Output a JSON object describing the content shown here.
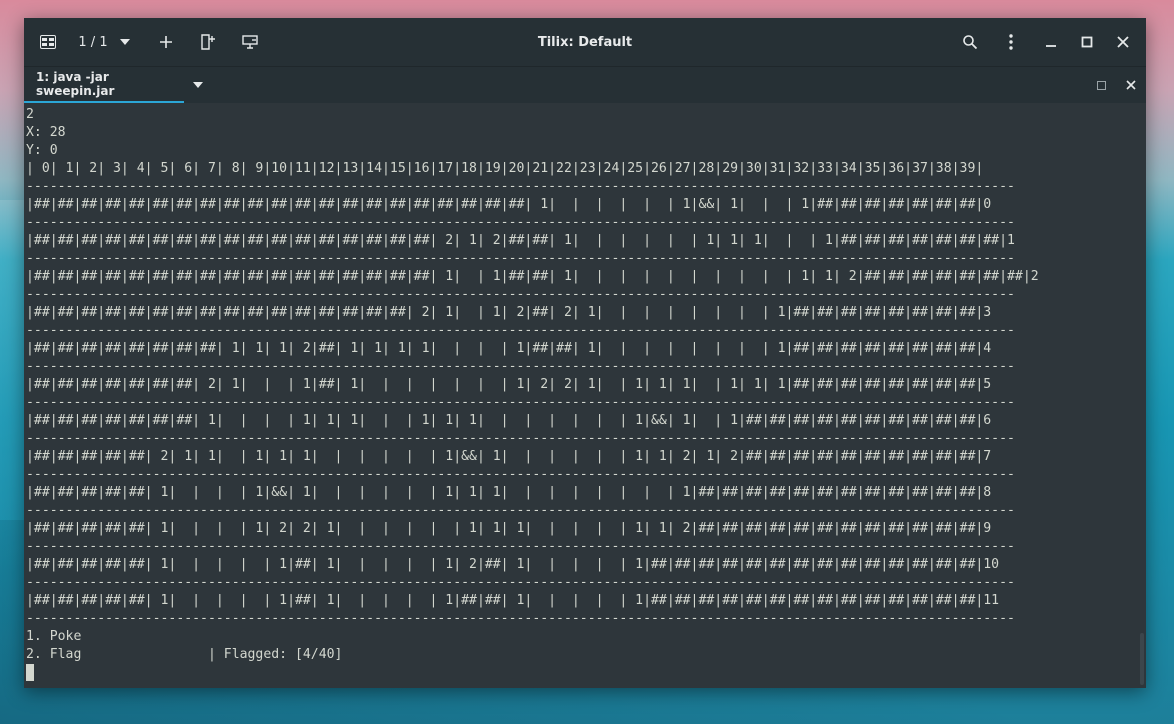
{
  "window": {
    "title": "Tilix: Default",
    "session_count": "1 / 1"
  },
  "tabs": [
    {
      "label": "1: java -jar sweepin.jar"
    }
  ],
  "icons": {
    "app": "terminal-app-icon",
    "session_dropdown": "chevron-down-icon",
    "new_session": "plus-icon",
    "add_terminal": "add-terminal-icon",
    "sync_input": "sync-input-icon",
    "search": "search-icon",
    "menu": "kebab-menu-icon",
    "minimize": "minimize-icon",
    "maximize": "maximize-icon",
    "close": "close-icon",
    "tab_dropdown": "chevron-down-icon",
    "pane_maximize": "pane-maximize-icon",
    "pane_close": "close-icon"
  },
  "terminal": {
    "lines": [
      "2",
      "X: 28",
      "Y: 0",
      "| 0| 1| 2| 3| 4| 5| 6| 7| 8| 9|10|11|12|13|14|15|16|17|18|19|20|21|22|23|24|25|26|27|28|29|30|31|32|33|34|35|36|37|38|39|",
      "-----------------------------------------------------------------------------------------------------------------------------",
      "|##|##|##|##|##|##|##|##|##|##|##|##|##|##|##|##|##|##|##|##|##| 1|  |  |  |  |  | 1|&&| 1|  |  | 1|##|##|##|##|##|##|##|0",
      "-----------------------------------------------------------------------------------------------------------------------------",
      "|##|##|##|##|##|##|##|##|##|##|##|##|##|##|##|##|##| 2| 1| 2|##|##| 1|  |  |  |  |  | 1| 1| 1|  |  | 1|##|##|##|##|##|##|##|1",
      "-----------------------------------------------------------------------------------------------------------------------------",
      "|##|##|##|##|##|##|##|##|##|##|##|##|##|##|##|##|##| 1|  | 1|##|##| 1|  |  |  |  |  |  |  |  |  | 1| 1| 2|##|##|##|##|##|##|##|2",
      "-----------------------------------------------------------------------------------------------------------------------------",
      "|##|##|##|##|##|##|##|##|##|##|##|##|##|##|##|##| 2| 1|  | 1| 2|##| 2| 1|  |  |  |  |  |  |  | 1|##|##|##|##|##|##|##|##|3",
      "-----------------------------------------------------------------------------------------------------------------------------",
      "|##|##|##|##|##|##|##|##| 1| 1| 1| 2|##| 1| 1| 1| 1|  |  |  | 1|##|##| 1|  |  |  |  |  |  |  | 1|##|##|##|##|##|##|##|##|4",
      "-----------------------------------------------------------------------------------------------------------------------------",
      "|##|##|##|##|##|##|##| 2| 1|  |  | 1|##| 1|  |  |  |  |  |  | 1| 2| 2| 1|  | 1| 1| 1|  | 1| 1| 1|##|##|##|##|##|##|##|##|5",
      "-----------------------------------------------------------------------------------------------------------------------------",
      "|##|##|##|##|##|##|##| 1|  |  |  | 1| 1| 1|  |  | 1| 1| 1|  |  |  |  |  |  | 1|&&| 1|  | 1|##|##|##|##|##|##|##|##|##|##|6",
      "-----------------------------------------------------------------------------------------------------------------------------",
      "|##|##|##|##|##| 2| 1| 1|  | 1| 1| 1|  |  |  |  |  | 1|&&| 1|  |  |  |  |  | 1| 1| 2| 1| 2|##|##|##|##|##|##|##|##|##|##|7",
      "-----------------------------------------------------------------------------------------------------------------------------",
      "|##|##|##|##|##| 1|  |  |  | 1|&&| 1|  |  |  |  |  | 1| 1| 1|  |  |  |  |  |  |  | 1|##|##|##|##|##|##|##|##|##|##|##|##|8",
      "-----------------------------------------------------------------------------------------------------------------------------",
      "|##|##|##|##|##| 1|  |  |  | 1| 2| 2| 1|  |  |  |  |  | 1| 1| 1|  |  |  |  | 1| 1| 2|##|##|##|##|##|##|##|##|##|##|##|##|9",
      "-----------------------------------------------------------------------------------------------------------------------------",
      "|##|##|##|##|##| 1|  |  |  |  | 1|##| 1|  |  |  |  | 1| 2|##| 1|  |  |  |  | 1|##|##|##|##|##|##|##|##|##|##|##|##|##|##|10",
      "-----------------------------------------------------------------------------------------------------------------------------",
      "|##|##|##|##|##| 1|  |  |  |  | 1|##| 1|  |  |  |  | 1|##|##| 1|  |  |  |  | 1|##|##|##|##|##|##|##|##|##|##|##|##|##|##|11",
      "-----------------------------------------------------------------------------------------------------------------------------",
      "1. Poke",
      "2. Flag                | Flagged: [4/40]"
    ]
  }
}
